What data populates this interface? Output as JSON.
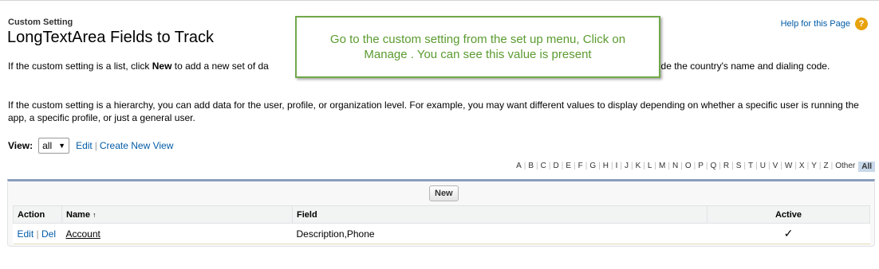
{
  "header": {
    "supertitle": "Custom Setting",
    "title": "LongTextArea Fields to Track",
    "help_link": "Help for this Page",
    "help_icon": "?"
  },
  "intro": {
    "p1_start": "If the custom setting is a list, click ",
    "p1_bold": "New",
    "p1_mid": " to add a new set of da",
    "p1_end": "ght include the country's name and dialing code.",
    "p2": "If the custom setting is a hierarchy, you can add data for the user, profile, or organization level. For example, you may want different values to display depending on whether a specific user is running the app, a specific profile, or just a general user."
  },
  "tooltip": {
    "text": "Go to the custom setting from the set up menu, Click on Manage . You can see this value is present"
  },
  "view": {
    "label": "View:",
    "selected": "all",
    "edit_label": "Edit",
    "separator": "|",
    "create_label": "Create New View"
  },
  "alpha_filter": {
    "letters": [
      "A",
      "B",
      "C",
      "D",
      "E",
      "F",
      "G",
      "H",
      "I",
      "J",
      "K",
      "L",
      "M",
      "N",
      "O",
      "P",
      "Q",
      "R",
      "S",
      "T",
      "U",
      "V",
      "W",
      "X",
      "Y",
      "Z",
      "Other"
    ],
    "selected": "All"
  },
  "list": {
    "new_button": "New",
    "columns": {
      "action": "Action",
      "name": "Name",
      "sort_indicator": "↑",
      "field": "Field",
      "active": "Active"
    },
    "rows": [
      {
        "edit": "Edit",
        "sep": "|",
        "del": "Del",
        "name": "Account",
        "field": "Description,Phone",
        "active": "✓"
      }
    ]
  }
}
